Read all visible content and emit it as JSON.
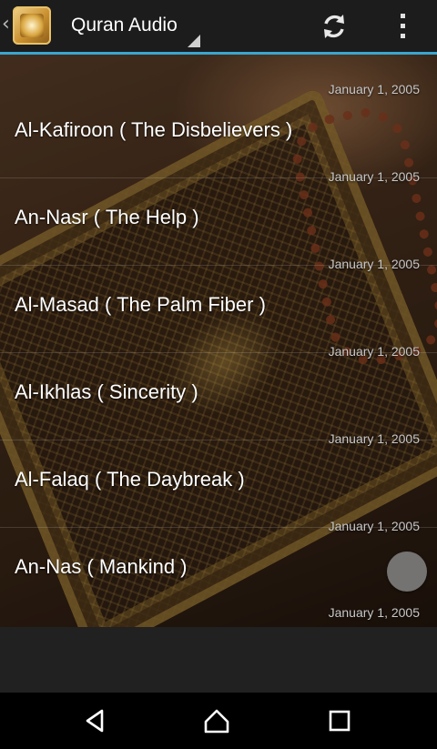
{
  "app": {
    "title": "Quran Audio",
    "back_glyph": "‹",
    "icons": {
      "app": "quran-book-icon",
      "refresh": "refresh-icon",
      "overflow": "overflow-menu-icon"
    },
    "accent_color": "#3aa6cf"
  },
  "list": {
    "header_date": "January 1, 2005",
    "items": [
      {
        "title": "Al-Kafiroon ( The Disbelievers )",
        "date": "January 1, 2005"
      },
      {
        "title": "An-Nasr ( The Help )",
        "date": "January 1, 2005"
      },
      {
        "title": "Al-Masad ( The Palm Fiber )",
        "date": "January 1, 2005"
      },
      {
        "title": "Al-Ikhlas ( Sincerity )",
        "date": "January 1, 2005"
      },
      {
        "title": "Al-Falaq ( The Daybreak )",
        "date": "January 1, 2005"
      },
      {
        "title": "An-Nas ( Mankind )",
        "date": "January 1, 2005"
      }
    ]
  },
  "navbar": {
    "icons": [
      "back-icon",
      "home-icon",
      "recents-icon"
    ]
  }
}
